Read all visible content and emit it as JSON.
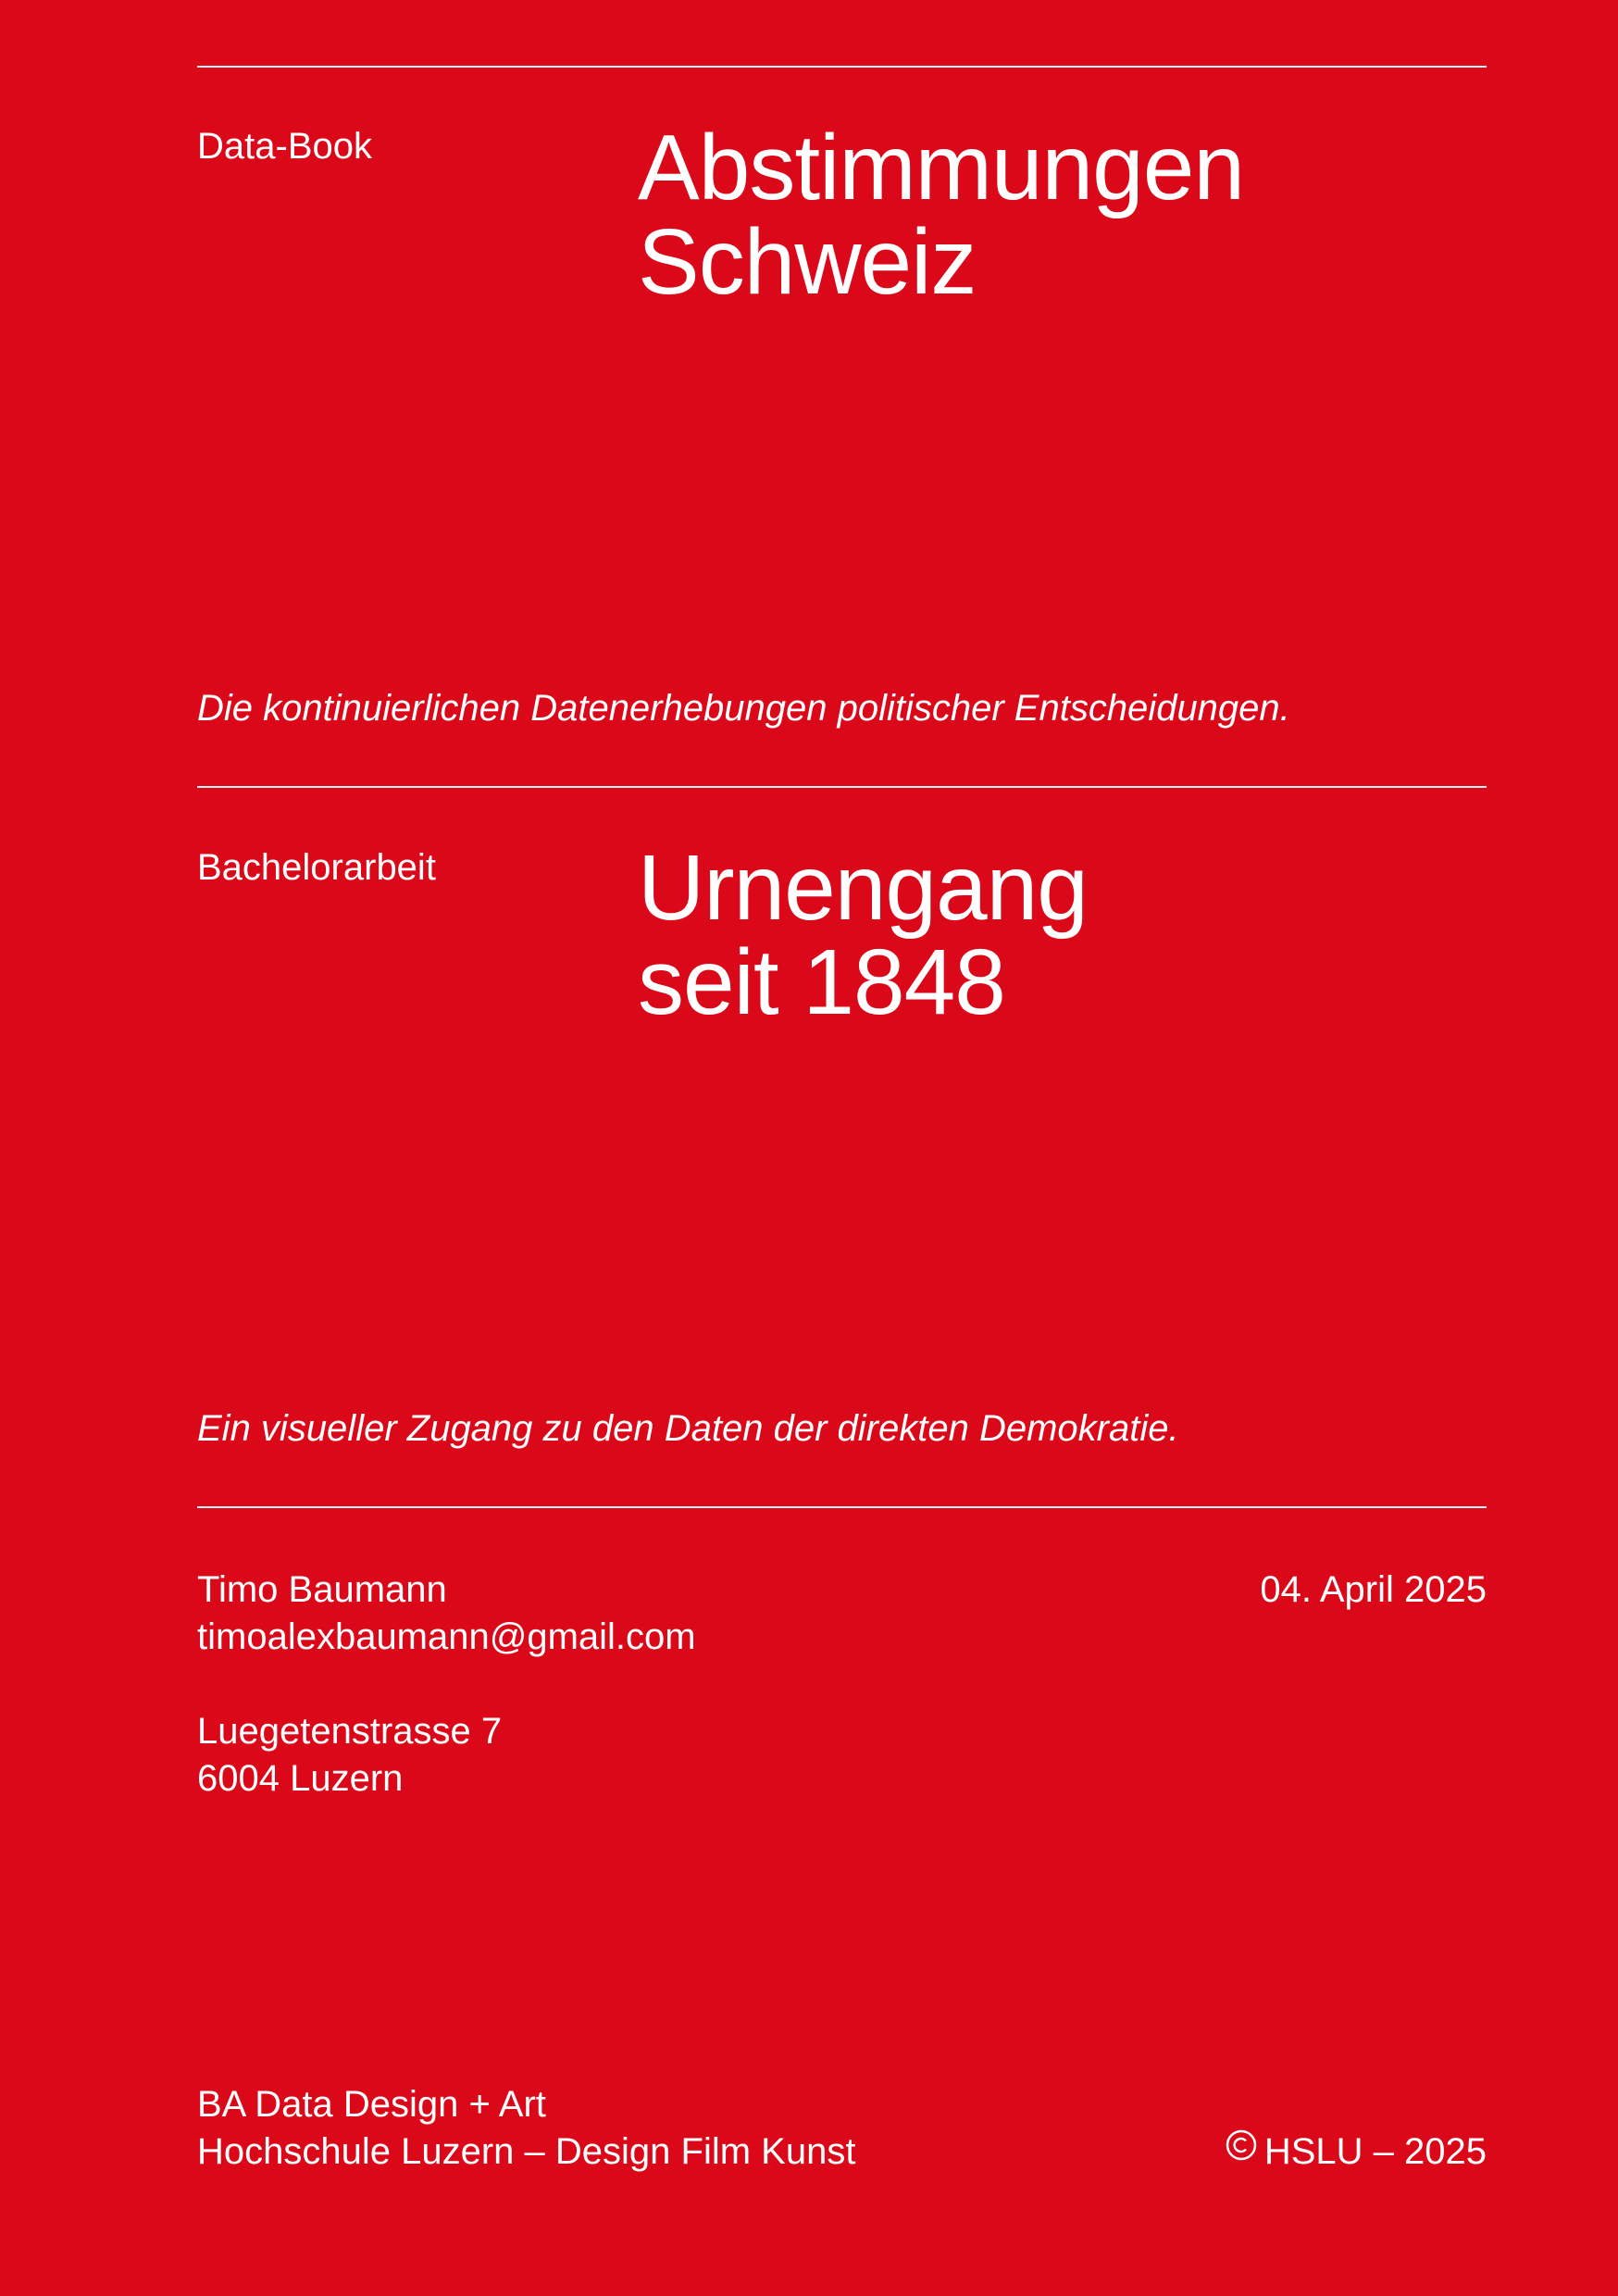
{
  "section1": {
    "label": "Data-Book",
    "title_line1": "Abstimmungen",
    "title_line2": "Schweiz",
    "tagline": "Die kontinuierlichen Datenerhebungen politischer Entscheidungen."
  },
  "section2": {
    "label": "Bachelorarbeit",
    "title_line1": "Urnengang",
    "title_line2": "seit 1848",
    "tagline": "Ein visueller Zugang zu den Daten der direkten Demokratie."
  },
  "author": {
    "name": "Timo Baumann",
    "email": "timoalexbaumann@gmail.com",
    "street": "Luegetenstrasse 7",
    "city": "6004 Luzern",
    "date": "04. April 2025"
  },
  "footer": {
    "program": "BA Data Design + Art",
    "school": "Hochschule Luzern – Design Film Kunst",
    "copyright": "HSLU – 2025"
  },
  "colors": {
    "background": "#DA0818",
    "text": "#FFFFFF"
  }
}
